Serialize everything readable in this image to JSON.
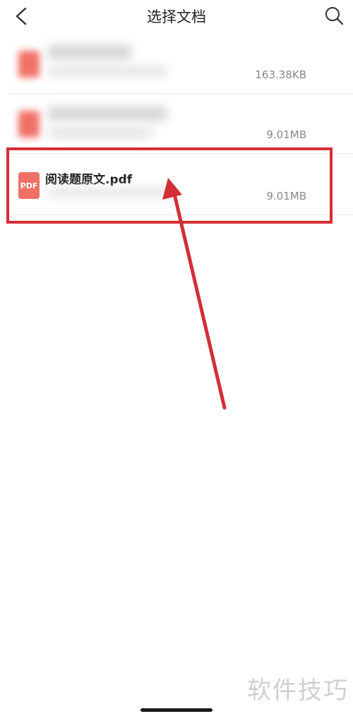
{
  "header": {
    "title": "选择文档",
    "back_icon": "chevron-left-icon",
    "search_icon": "search-icon"
  },
  "files": [
    {
      "name": "",
      "size": "163.38KB",
      "icon_label": ""
    },
    {
      "name": "",
      "size": "9.01MB",
      "icon_label": ""
    },
    {
      "name": "阅读题原文.pdf",
      "size": "9.01MB",
      "icon_label": "PDF"
    }
  ],
  "annotation": {
    "highlight_color": "#d32f36",
    "arrow_color": "#d32f36"
  },
  "watermark": "软件技巧"
}
